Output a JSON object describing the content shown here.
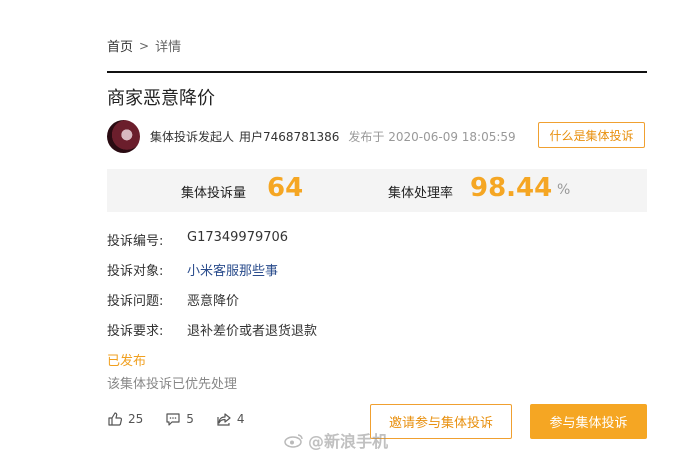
{
  "breadcrumb": {
    "home": "首页",
    "separator": ">",
    "current": "详情"
  },
  "complaint": {
    "title": "商家恶意降价",
    "initiator_label": "集体投诉发起人",
    "user_name": "用户7468781386",
    "published_prefix": "发布于",
    "published_time": "2020-06-09 18:05:59",
    "what_button": "什么是集体投诉"
  },
  "stats": {
    "count_label": "集体投诉量",
    "count_value": "64",
    "rate_label": "集体处理率",
    "rate_value": "98.44",
    "rate_unit": "%"
  },
  "fields": {
    "number_label": "投诉编号:",
    "number_value": "G17349979706",
    "target_label": "投诉对象:",
    "target_value": "小米客服那些事",
    "issue_label": "投诉问题:",
    "issue_value": "恶意降价",
    "request_label": "投诉要求:",
    "request_value": "退补差价或者退货退款"
  },
  "status": {
    "published": "已发布",
    "note": "该集体投诉已优先处理"
  },
  "actions": {
    "likes": "25",
    "comments": "5",
    "shares": "4",
    "invite_button": "邀请参与集体投诉",
    "join_button": "参与集体投诉"
  },
  "watermark": {
    "handle": "@新浪手机"
  },
  "colors": {
    "accent": "#f5a623",
    "link": "#2a4c8c",
    "muted": "#999999"
  }
}
